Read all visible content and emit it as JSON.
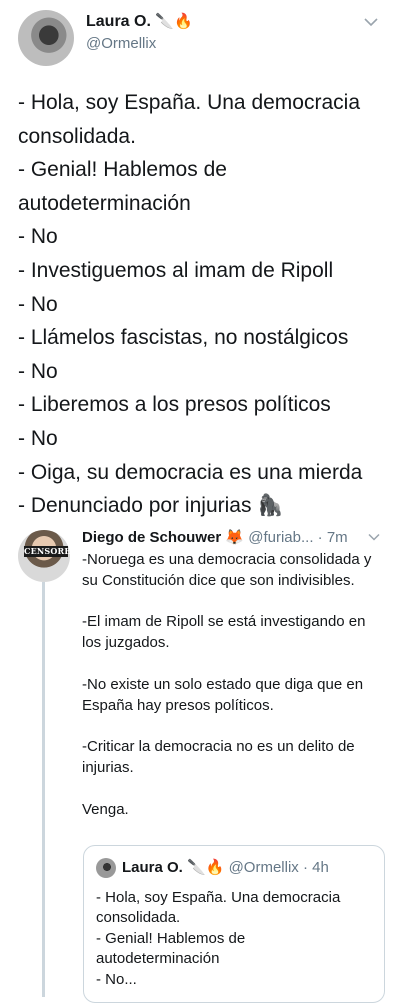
{
  "main_tweet": {
    "name": "Laura O.",
    "name_emoji": "🔪🔥",
    "handle": "@Ormellix",
    "menu_icon": "chevron-down-icon",
    "lines": [
      "- Hola, soy España. Una democracia",
      "consolidada.",
      "- Genial! Hablemos de",
      "autodeterminación",
      "- No",
      "- Investiguemos al imam de Ripoll",
      "- No",
      "- Llámelos fascistas, no nostálgicos",
      "- No",
      "- Liberemos a los presos políticos",
      "- No",
      "- Oiga, su democracia es una mierda",
      "- Denunciado por injurias 🦍"
    ]
  },
  "reply_tweet": {
    "name": "Diego de Schouwer",
    "name_emoji": "🦊",
    "handle": "@furiab...",
    "time": "· 7m",
    "avatar_badge": "CENSORED",
    "paragraphs": [
      "-Noruega es una democracia consolidada y su Constitución dice que son indivisibles.",
      "-El imam de Ripoll se está investigando en los juzgados.",
      "-No existe un solo estado que diga que en España hay presos políticos.",
      "-Criticar la democracia no es un delito de injurias.",
      "Venga."
    ]
  },
  "quoted_tweet": {
    "name": "Laura O.",
    "name_emoji": "🔪🔥",
    "handle": "@Ormellix",
    "time": "· 4h",
    "lines": [
      "- Hola, soy España. Una democracia",
      "consolidada.",
      "- Genial! Hablemos de",
      "autodeterminación",
      "- No..."
    ]
  }
}
